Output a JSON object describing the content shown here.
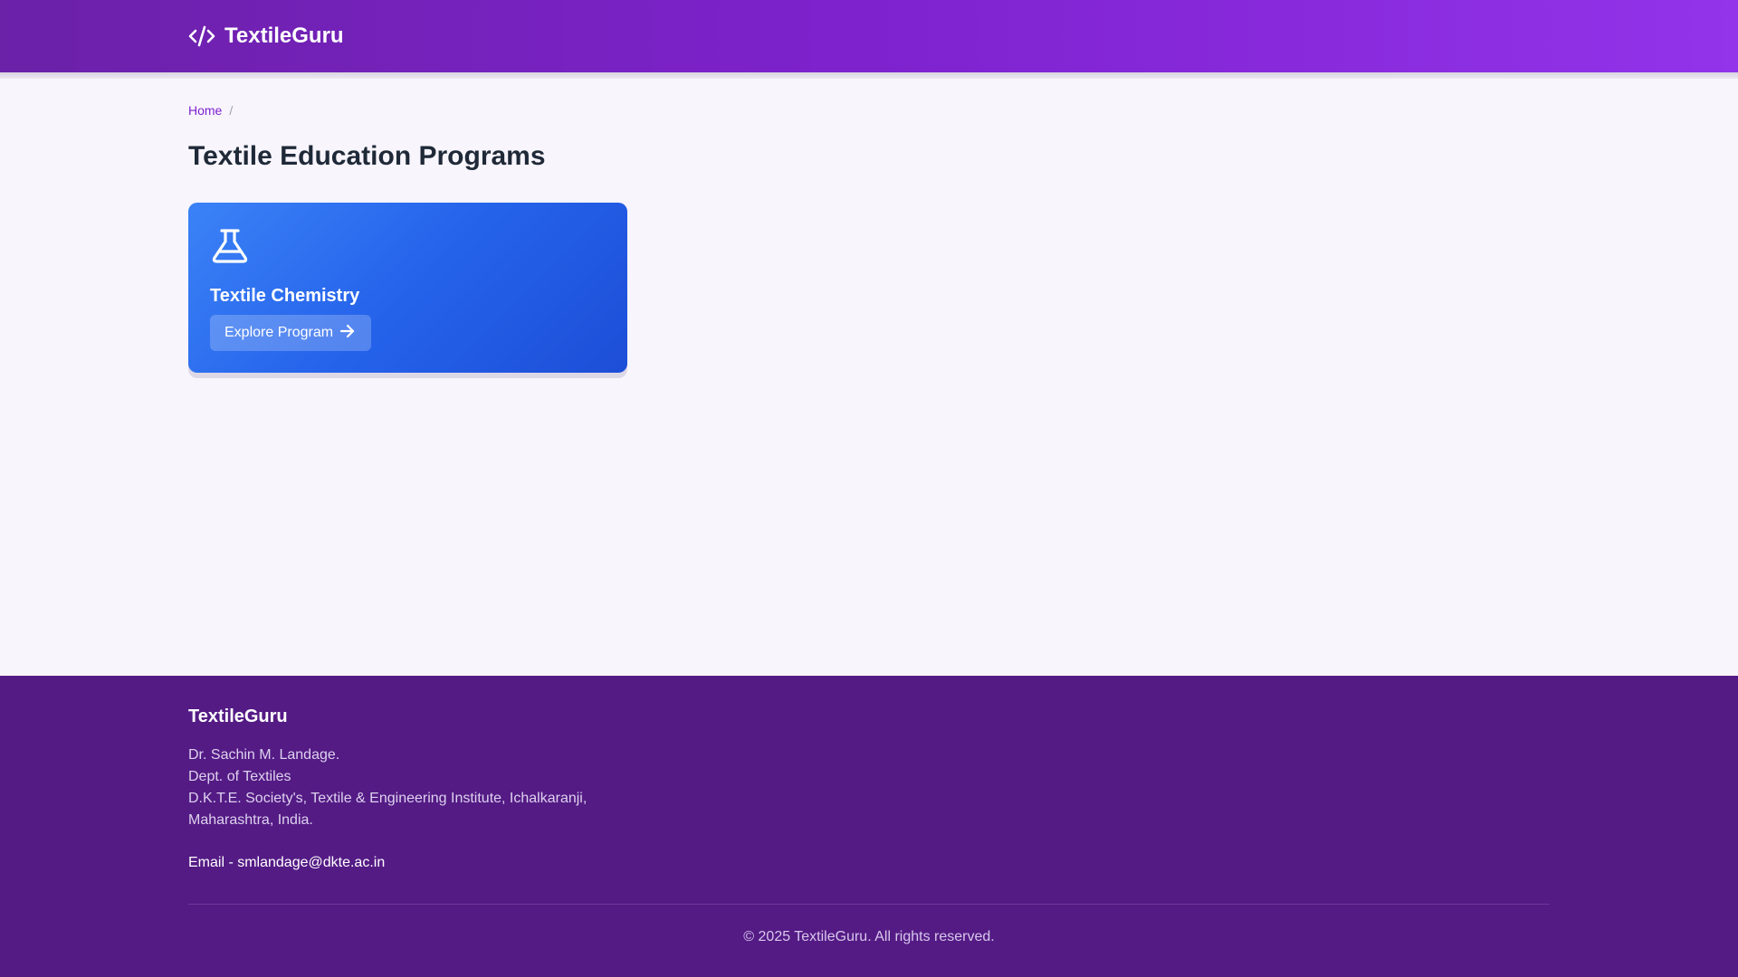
{
  "header": {
    "brand": "TextileGuru",
    "brand_icon": "code-icon",
    "colors": {
      "start": "#6b21a8",
      "end": "#9333ea"
    }
  },
  "breadcrumb": {
    "home": "Home",
    "separator": "/"
  },
  "page": {
    "title": "Textile Education Programs"
  },
  "programs": [
    {
      "icon": "flask-icon",
      "title": "Textile Chemistry",
      "button_label": "Explore Program",
      "button_icon": "arrow-right-icon",
      "color": "#2563eb"
    }
  ],
  "footer": {
    "brand": "TextileGuru",
    "address_lines": [
      "Dr. Sachin M. Landage.",
      "Dept. of Textiles",
      "D.K.T.E. Society's, Textile & Engineering Institute, Ichalkaranji,",
      "Maharashtra, India."
    ],
    "email": "Email - smlandage@dkte.ac.in",
    "copyright": "© 2025 TextileGuru. All rights reserved.",
    "background": "#541b85"
  }
}
